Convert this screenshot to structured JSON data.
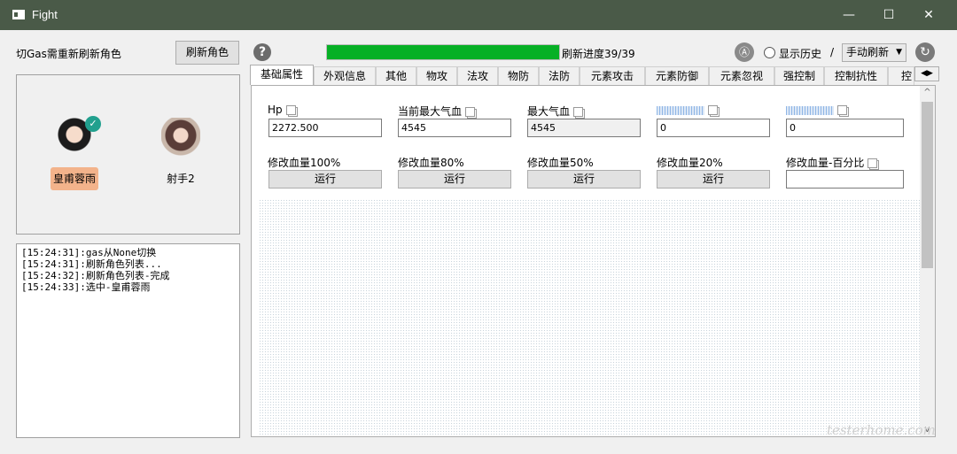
{
  "window": {
    "title": "Fight",
    "minimize": "—",
    "maximize": "☐",
    "close": "✕"
  },
  "topbar": {
    "hint_label": "切Gas需重新刷新角色",
    "refresh_roles_button": "刷新角色",
    "progress_label": "刷新进度39/39",
    "progress_fraction": 1.0,
    "show_history_label": "显示历史",
    "separator": "/",
    "refresh_mode": "手动刷新"
  },
  "characters": [
    {
      "name": "皇甫蓉雨",
      "selected": true
    },
    {
      "name": "射手2",
      "selected": false
    }
  ],
  "log": [
    "[15:24:31]:gas从None切换",
    "[15:24:31]:刷新角色列表...",
    "[15:24:32]:刷新角色列表-完成",
    "[15:24:33]:选中-皇甫蓉雨"
  ],
  "tabs": [
    "基础属性",
    "外观信息",
    "其他",
    "物攻",
    "法攻",
    "物防",
    "法防",
    "元素攻击",
    "元素防御",
    "元素忽视",
    "强控制",
    "控制抗性",
    "控"
  ],
  "fields": [
    {
      "label": "Hp",
      "value": "2272.500"
    },
    {
      "label": "当前最大气血",
      "value": "4545"
    },
    {
      "label": "最大气血",
      "value": "4545"
    },
    {
      "label": "",
      "value": "0"
    },
    {
      "label": "",
      "value": "0"
    }
  ],
  "actions": [
    {
      "label": "修改血量100%",
      "button": "运行"
    },
    {
      "label": "修改血量80%",
      "button": "运行"
    },
    {
      "label": "修改血量50%",
      "button": "运行"
    },
    {
      "label": "修改血量20%",
      "button": "运行"
    }
  ],
  "percent_action": {
    "label": "修改血量-百分比",
    "value": ""
  },
  "watermark": "testerhome.com",
  "colors": {
    "titlebar": "#4a5a48",
    "progress": "#06b025",
    "selected_char": "#f3b38b"
  }
}
